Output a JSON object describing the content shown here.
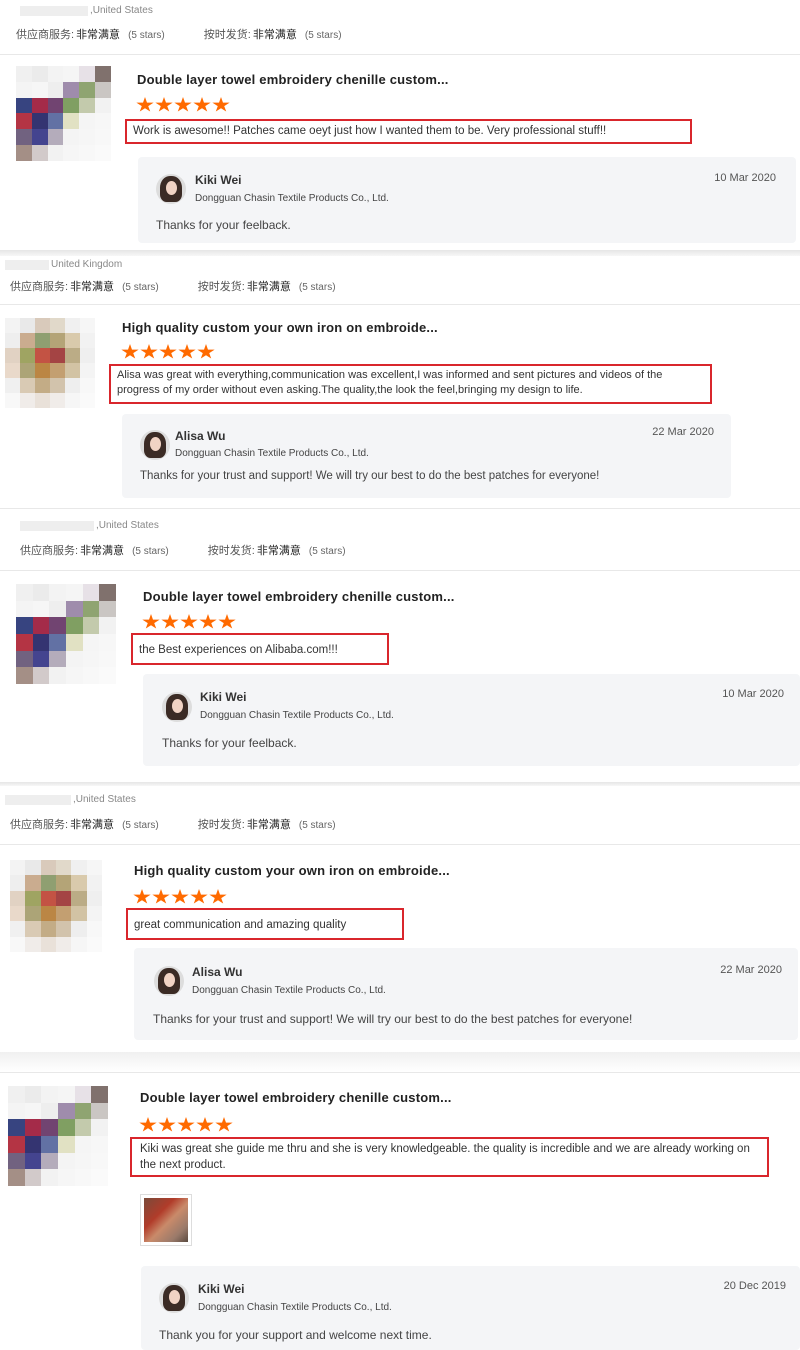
{
  "labels": {
    "supplier_service": "供应商服务:",
    "on_time_shipment": "按时发货:",
    "very_satisfied": "非常满意",
    "five_stars": "(5 stars)",
    "company": "Dongguan Chasin Textile Products Co., Ltd."
  },
  "reviews": [
    {
      "country": ",United States",
      "product_title": "Double layer towel embroidery chenille custom...",
      "rating": 5,
      "comment": "Work is awesome!! Patches came oeyt just how I wanted them to be. Very professional stuff!!",
      "reply": {
        "name": "Kiki Wei",
        "date": "10 Mar 2020",
        "text": "Thanks for your feelback."
      }
    },
    {
      "country": "United Kingdom",
      "product_title": "High quality custom your own iron on embroide...",
      "rating": 5,
      "comment": "Alisa was great with everything,communication was excellent,I was informed and sent pictures and videos of the progress of my order without even asking.The quality,the look the feel,bringing my design to life.",
      "reply": {
        "name": "Alisa Wu",
        "date": "22 Mar 2020",
        "text": "Thanks for your trust and support! We will try our best to do the best patches for everyone!"
      }
    },
    {
      "country": ",United States",
      "product_title": "Double layer towel embroidery chenille custom...",
      "rating": 5,
      "comment": "the Best experiences on Alibaba.com!!!",
      "reply": {
        "name": "Kiki Wei",
        "date": "10 Mar 2020",
        "text": "Thanks for your feelback."
      }
    },
    {
      "country": ",United States",
      "product_title": "High quality custom your own iron on embroide...",
      "rating": 5,
      "comment": "great communication and amazing quality",
      "reply": {
        "name": "Alisa Wu",
        "date": "22 Mar 2020",
        "text": "Thanks for your trust and support! We will try our best to do the best patches for everyone!"
      }
    },
    {
      "country": "",
      "product_title": "Double layer towel embroidery chenille custom...",
      "rating": 5,
      "comment": "Kiki was great she guide me thru and she is very knowledgeable. the quality is incredible and we are already working on the next product.",
      "reply": {
        "name": "Kiki Wei",
        "date": "20 Dec 2019",
        "text": "Thank you for your support and welcome next time."
      }
    }
  ],
  "colors": {
    "star": "#ff6a00",
    "highlight_border": "#d9262c",
    "reply_bg": "#f4f5f7"
  }
}
